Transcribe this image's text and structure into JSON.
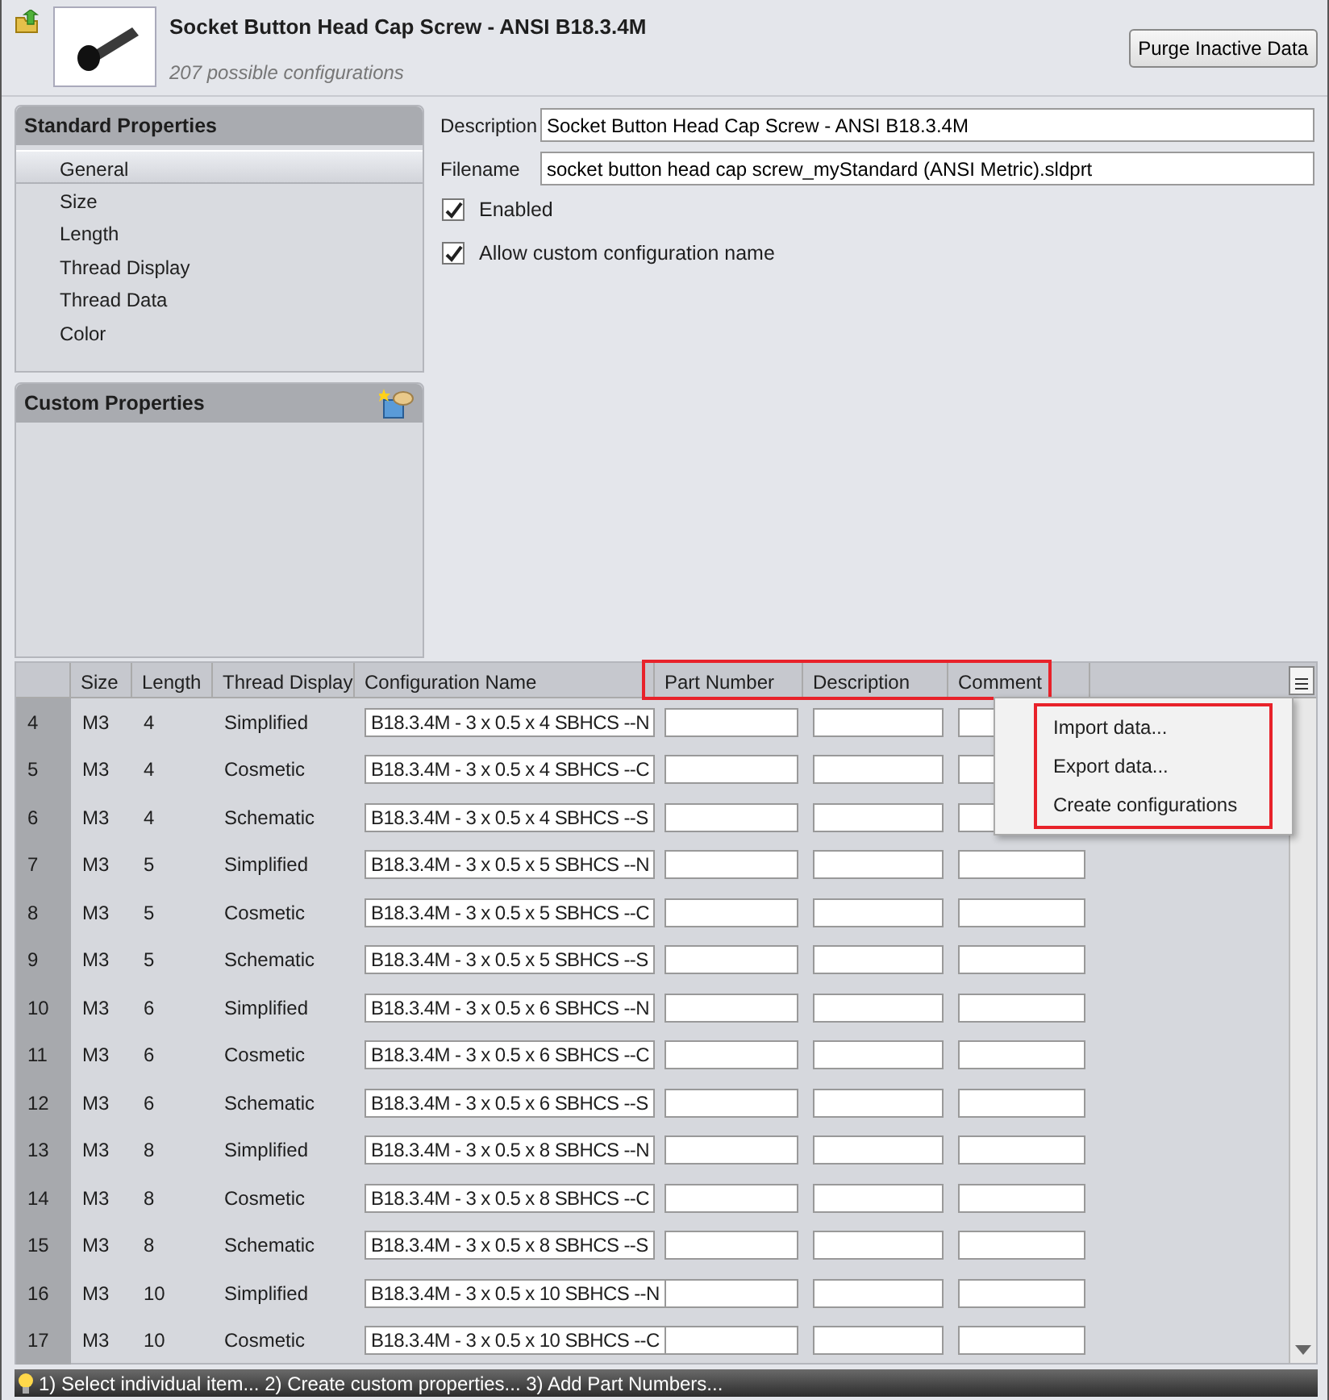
{
  "header": {
    "title": "Socket Button Head Cap Screw - ANSI B18.3.4M",
    "subtitle": "207 possible configurations",
    "button": "Purge Inactive Data"
  },
  "standard_properties": {
    "title": "Standard Properties",
    "items": [
      {
        "label": "General",
        "selected": true
      },
      {
        "label": "Size",
        "selected": false
      },
      {
        "label": "Length",
        "selected": false
      },
      {
        "label": "Thread Display",
        "selected": false
      },
      {
        "label": "Thread Data",
        "selected": false
      },
      {
        "label": "Color",
        "selected": false
      }
    ]
  },
  "custom_properties": {
    "title": "Custom Properties"
  },
  "form": {
    "fields": [
      {
        "label": "Description",
        "value": "Socket Button Head Cap Screw - ANSI B18.3.4M"
      },
      {
        "label": "Filename",
        "value": "socket button head cap screw_myStandard (ANSI Metric).sldprt"
      }
    ],
    "checkboxes": [
      {
        "label": "Enabled",
        "checked": true
      },
      {
        "label": "Allow custom configuration name",
        "checked": true
      }
    ]
  },
  "table": {
    "columns": [
      "Size",
      "Length",
      "Thread Display",
      "Configuration Name",
      "Part Number",
      "Description",
      "Comment"
    ],
    "rows": [
      {
        "index": "4",
        "size": "M3",
        "length": "4",
        "thread_display": "Simplified",
        "configuration_name": "B18.3.4M - 3 x 0.5 x 4 SBHCS --N"
      },
      {
        "index": "5",
        "size": "M3",
        "length": "4",
        "thread_display": "Cosmetic",
        "configuration_name": "B18.3.4M - 3 x 0.5 x 4 SBHCS --C"
      },
      {
        "index": "6",
        "size": "M3",
        "length": "4",
        "thread_display": "Schematic",
        "configuration_name": "B18.3.4M - 3 x 0.5 x 4 SBHCS --S"
      },
      {
        "index": "7",
        "size": "M3",
        "length": "5",
        "thread_display": "Simplified",
        "configuration_name": "B18.3.4M - 3 x 0.5 x 5 SBHCS --N"
      },
      {
        "index": "8",
        "size": "M3",
        "length": "5",
        "thread_display": "Cosmetic",
        "configuration_name": "B18.3.4M - 3 x 0.5 x 5 SBHCS --C"
      },
      {
        "index": "9",
        "size": "M3",
        "length": "5",
        "thread_display": "Schematic",
        "configuration_name": "B18.3.4M - 3 x 0.5 x 5 SBHCS --S"
      },
      {
        "index": "10",
        "size": "M3",
        "length": "6",
        "thread_display": "Simplified",
        "configuration_name": "B18.3.4M - 3 x 0.5 x 6 SBHCS --N"
      },
      {
        "index": "11",
        "size": "M3",
        "length": "6",
        "thread_display": "Cosmetic",
        "configuration_name": "B18.3.4M - 3 x 0.5 x 6 SBHCS --C"
      },
      {
        "index": "12",
        "size": "M3",
        "length": "6",
        "thread_display": "Schematic",
        "configuration_name": "B18.3.4M - 3 x 0.5 x 6 SBHCS --S"
      },
      {
        "index": "13",
        "size": "M3",
        "length": "8",
        "thread_display": "Simplified",
        "configuration_name": "B18.3.4M - 3 x 0.5 x 8 SBHCS --N"
      },
      {
        "index": "14",
        "size": "M3",
        "length": "8",
        "thread_display": "Cosmetic",
        "configuration_name": "B18.3.4M - 3 x 0.5 x 8 SBHCS --C"
      },
      {
        "index": "15",
        "size": "M3",
        "length": "8",
        "thread_display": "Schematic",
        "configuration_name": "B18.3.4M - 3 x 0.5 x 8 SBHCS --S"
      },
      {
        "index": "16",
        "size": "M3",
        "length": "10",
        "thread_display": "Simplified",
        "configuration_name": "B18.3.4M - 3 x 0.5 x 10 SBHCS --N"
      },
      {
        "index": "17",
        "size": "M3",
        "length": "10",
        "thread_display": "Cosmetic",
        "configuration_name": "B18.3.4M - 3 x 0.5 x 10 SBHCS --C"
      }
    ]
  },
  "context_menu": {
    "items": [
      "Import data...",
      "Export data...",
      "Create configurations"
    ]
  },
  "status_bar": "1) Select individual item... 2) Create custom properties... 3) Add Part Numbers..."
}
